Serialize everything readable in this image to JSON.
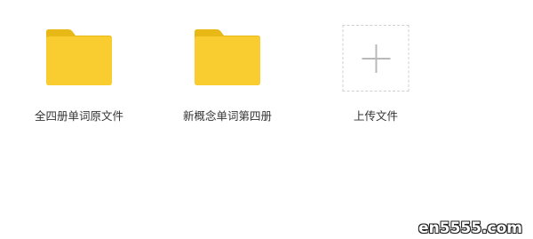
{
  "items": [
    {
      "label": "全四册单词原文件",
      "icon": "folder-icon"
    },
    {
      "label": "新概念单词第四册",
      "icon": "folder-icon"
    },
    {
      "label": "上传文件",
      "icon": "plus-icon"
    }
  ],
  "colors": {
    "folder_back": "#E8B816",
    "folder_front": "#F9CC30",
    "upload_border": "#CFCFCF",
    "plus": "#B9B9B9",
    "label_text": "#333333"
  },
  "watermark": {
    "text": "en5555.com"
  }
}
